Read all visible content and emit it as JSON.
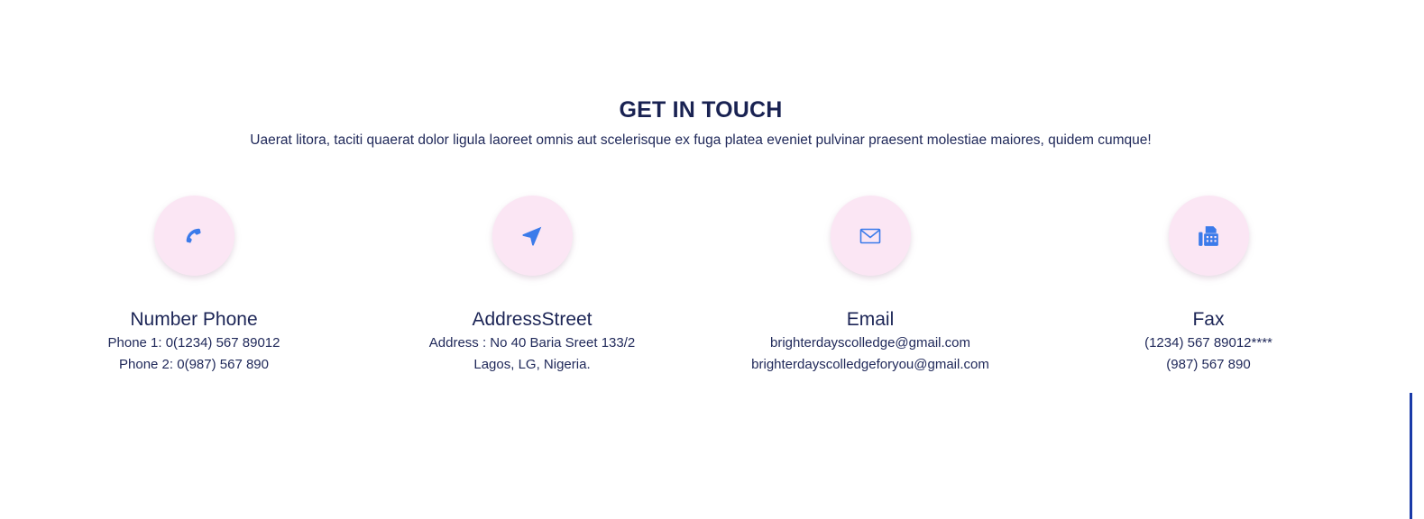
{
  "section": {
    "title": "GET IN TOUCH",
    "subtitle": "Uaerat litora, taciti quaerat dolor ligula laoreet omnis aut scelerisque ex fuga platea eveniet pulvinar praesent molestiae maiores, quidem cumque!"
  },
  "cards": [
    {
      "icon": "phone-icon",
      "title": "Number Phone",
      "line1": "Phone 1: 0(1234) 567 89012",
      "line2": "Phone 2: 0(987) 567 890"
    },
    {
      "icon": "location-arrow-icon",
      "title": "AddressStreet",
      "line1": "Address : No 40 Baria Sreet 133/2",
      "line2": "Lagos, LG, Nigeria."
    },
    {
      "icon": "envelope-icon",
      "title": "Email",
      "line1": "brighterdayscolledge@gmail.com",
      "line2": "brighterdayscolledgeforyou@gmail.com"
    },
    {
      "icon": "fax-icon",
      "title": "Fax",
      "line1": "(1234) 567 89012****",
      "line2": "(987) 567 890"
    }
  ],
  "colors": {
    "heading": "#192252",
    "icon_accent": "#3b7bea",
    "icon_bg": "#fbe6f4",
    "scroll_indicator": "#1a3aa8"
  }
}
